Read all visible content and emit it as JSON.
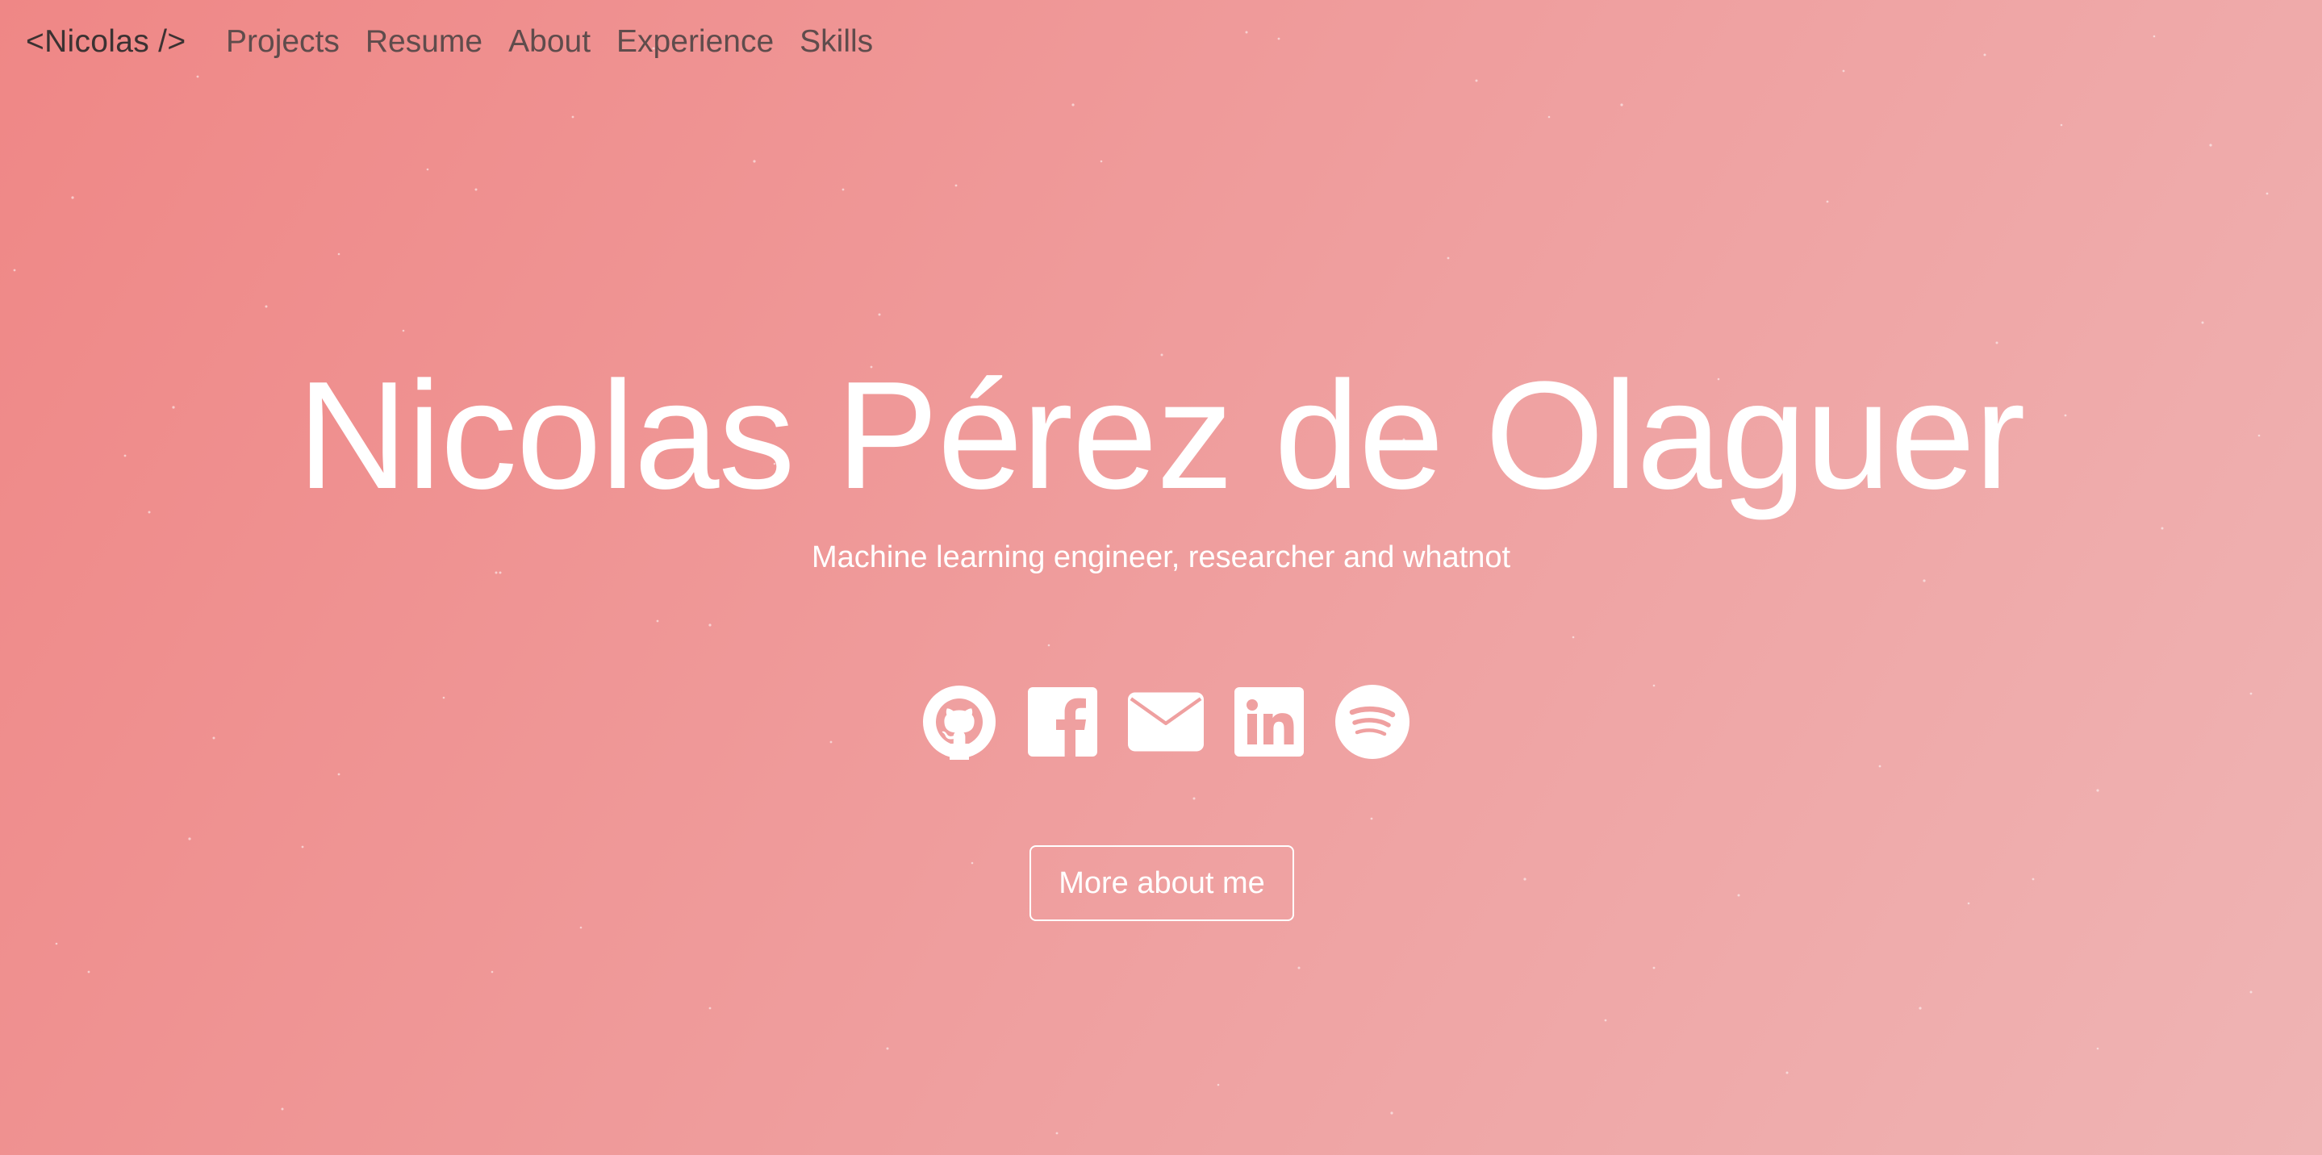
{
  "nav": {
    "brand": "<Nicolas />",
    "links": [
      "Projects",
      "Resume",
      "About",
      "Experience",
      "Skills"
    ]
  },
  "hero": {
    "title": "Nicolas Pérez de Olaguer",
    "subtitle": "Machine learning engineer, researcher and whatnot",
    "cta_label": "More about me"
  },
  "socials": [
    {
      "icon": "github-icon"
    },
    {
      "icon": "facebook-icon"
    },
    {
      "icon": "email-icon"
    },
    {
      "icon": "linkedin-icon"
    },
    {
      "icon": "spotify-icon"
    }
  ],
  "colors": {
    "background_start": "#ef8786",
    "background_end": "#efb4b4",
    "text_light": "#ffffff",
    "nav_text": "#5f4c4c",
    "brand_text": "#3b3232"
  }
}
